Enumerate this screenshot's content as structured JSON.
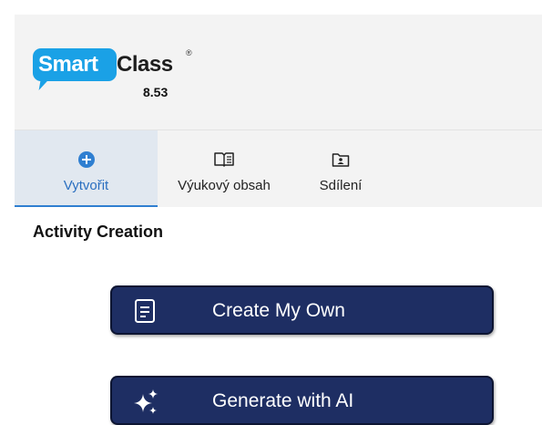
{
  "app": {
    "logo_smart": "Smart",
    "logo_class": "Class",
    "logo_registered": "®",
    "version": "8.53",
    "brand_color": "#1aa1e6"
  },
  "tabs": [
    {
      "label": "Vytvořit",
      "icon": "plus-circle-icon",
      "active": true
    },
    {
      "label": "Výukový obsah",
      "icon": "open-book-icon",
      "active": false
    },
    {
      "label": "Sdílení",
      "icon": "shared-folder-icon",
      "active": false
    }
  ],
  "main": {
    "section_title": "Activity Creation",
    "buttons": [
      {
        "label": "Create My Own",
        "icon": "document-icon"
      },
      {
        "label": "Generate with AI",
        "icon": "sparkle-icon"
      }
    ],
    "button_color": "#1e2e63"
  }
}
